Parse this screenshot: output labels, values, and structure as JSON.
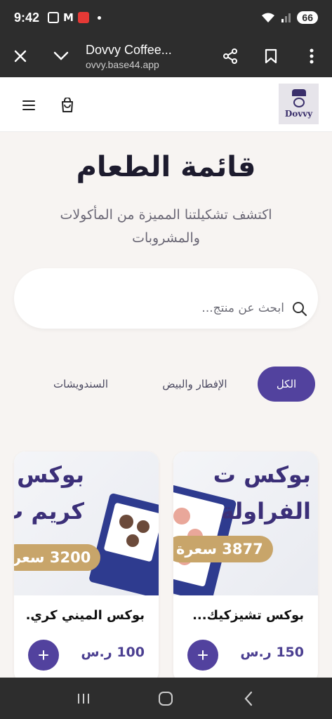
{
  "status_bar": {
    "time": "9:42",
    "battery": "66"
  },
  "browser": {
    "title": "Dovvy Coffee...",
    "url": "ovvy.base44.app"
  },
  "site": {
    "logo_text": "Dovvy"
  },
  "hero": {
    "title": "قائمة الطعام",
    "subtitle": "اكتشف تشكيلتنا المميزة من المأكولات والمشروبات"
  },
  "search": {
    "placeholder": "ابحث عن منتج..."
  },
  "tabs": [
    {
      "label": "الكل",
      "active": true
    },
    {
      "label": "الإفطار والبيض",
      "active": false
    },
    {
      "label": "السندويشات",
      "active": false
    }
  ],
  "products": [
    {
      "name": "بوكس تشيزكيك...",
      "price": "150 ر.س",
      "image_line1": "بوكس ت",
      "image_line2": "الفراولة",
      "image_price": "3877 سعرة"
    },
    {
      "name": "بوكس الميني كري...",
      "price": "100 ر.س",
      "image_line1": "بوكس",
      "image_line2": "كريم ب",
      "image_price": "3200 سعر"
    }
  ],
  "colors": {
    "accent": "#52429e",
    "price_text": "#4b3f91",
    "gold": "#c8a56a",
    "background": "#f7f4f2",
    "system_bar": "#2d2d2d"
  },
  "icons": {
    "close": "close-icon",
    "chevron": "chevron-down-icon",
    "share": "share-icon",
    "bookmark": "bookmark-icon",
    "more": "more-vertical-icon",
    "menu": "menu-icon",
    "cart": "cart-icon",
    "search": "search-icon",
    "plus": "plus-icon"
  }
}
